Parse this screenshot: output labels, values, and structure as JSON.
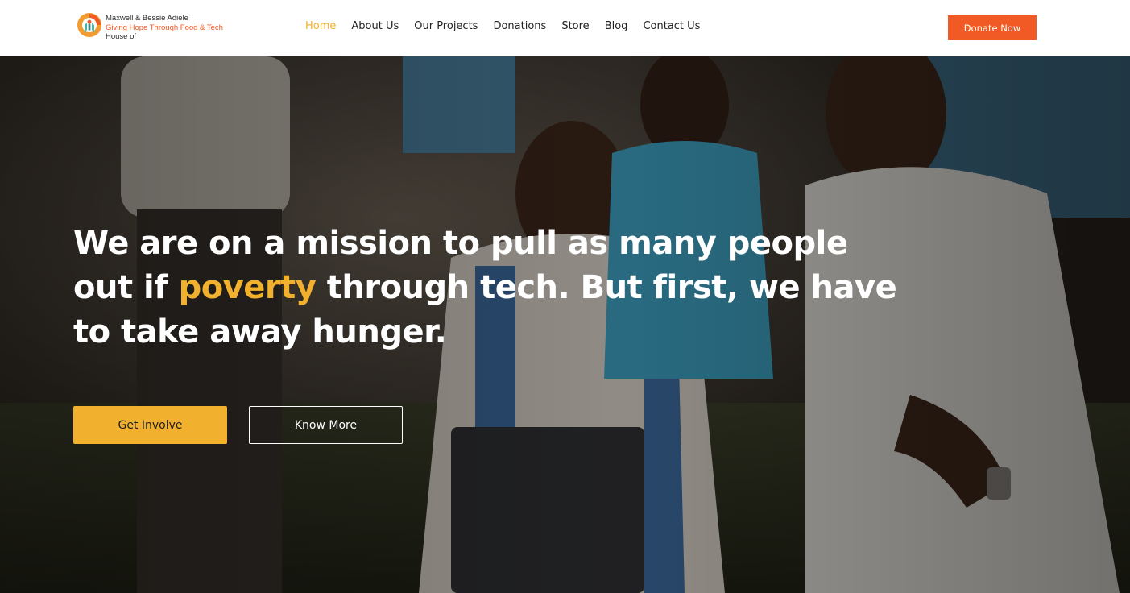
{
  "brand": {
    "line1": "Maxwell & Bessie Adiele",
    "line2": "Giving Hope Through Food & Tech",
    "line3": "House of",
    "icon": "hands-logo-icon",
    "accent_color": "#f15a24"
  },
  "nav": {
    "items": [
      {
        "label": "Home",
        "active": true
      },
      {
        "label": "About Us",
        "active": false
      },
      {
        "label": "Our Projects",
        "active": false
      },
      {
        "label": "Donations",
        "active": false
      },
      {
        "label": "Store",
        "active": false
      },
      {
        "label": "Blog",
        "active": false
      },
      {
        "label": "Contact Us",
        "active": false
      }
    ],
    "active_color": "#f1b12e",
    "cta_label": "Donate Now",
    "cta_color": "#f15a24"
  },
  "hero": {
    "headline_part1": "We are on a mission to pull as many people out if",
    "headline_accent": "poverty",
    "headline_part2": "through tech. But first, we have to take away hunger.",
    "accent_color": "#f1b12e",
    "primary_button": "Get Involve",
    "secondary_button": "Know More"
  }
}
